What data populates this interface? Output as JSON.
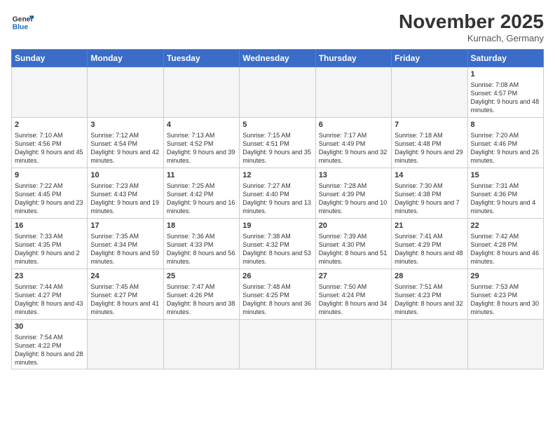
{
  "header": {
    "logo_general": "General",
    "logo_blue": "Blue",
    "month_title": "November 2025",
    "location": "Kurnach, Germany"
  },
  "weekdays": [
    "Sunday",
    "Monday",
    "Tuesday",
    "Wednesday",
    "Thursday",
    "Friday",
    "Saturday"
  ],
  "days": [
    {
      "num": "",
      "info": "",
      "empty": true
    },
    {
      "num": "",
      "info": "",
      "empty": true
    },
    {
      "num": "",
      "info": "",
      "empty": true
    },
    {
      "num": "",
      "info": "",
      "empty": true
    },
    {
      "num": "",
      "info": "",
      "empty": true
    },
    {
      "num": "",
      "info": "",
      "empty": true
    },
    {
      "num": "1",
      "info": "Sunrise: 7:08 AM\nSunset: 4:57 PM\nDaylight: 9 hours\nand 48 minutes."
    },
    {
      "num": "2",
      "info": "Sunrise: 7:10 AM\nSunset: 4:56 PM\nDaylight: 9 hours\nand 45 minutes."
    },
    {
      "num": "3",
      "info": "Sunrise: 7:12 AM\nSunset: 4:54 PM\nDaylight: 9 hours\nand 42 minutes."
    },
    {
      "num": "4",
      "info": "Sunrise: 7:13 AM\nSunset: 4:52 PM\nDaylight: 9 hours\nand 39 minutes."
    },
    {
      "num": "5",
      "info": "Sunrise: 7:15 AM\nSunset: 4:51 PM\nDaylight: 9 hours\nand 35 minutes."
    },
    {
      "num": "6",
      "info": "Sunrise: 7:17 AM\nSunset: 4:49 PM\nDaylight: 9 hours\nand 32 minutes."
    },
    {
      "num": "7",
      "info": "Sunrise: 7:18 AM\nSunset: 4:48 PM\nDaylight: 9 hours\nand 29 minutes."
    },
    {
      "num": "8",
      "info": "Sunrise: 7:20 AM\nSunset: 4:46 PM\nDaylight: 9 hours\nand 26 minutes."
    },
    {
      "num": "9",
      "info": "Sunrise: 7:22 AM\nSunset: 4:45 PM\nDaylight: 9 hours\nand 23 minutes."
    },
    {
      "num": "10",
      "info": "Sunrise: 7:23 AM\nSunset: 4:43 PM\nDaylight: 9 hours\nand 19 minutes."
    },
    {
      "num": "11",
      "info": "Sunrise: 7:25 AM\nSunset: 4:42 PM\nDaylight: 9 hours\nand 16 minutes."
    },
    {
      "num": "12",
      "info": "Sunrise: 7:27 AM\nSunset: 4:40 PM\nDaylight: 9 hours\nand 13 minutes."
    },
    {
      "num": "13",
      "info": "Sunrise: 7:28 AM\nSunset: 4:39 PM\nDaylight: 9 hours\nand 10 minutes."
    },
    {
      "num": "14",
      "info": "Sunrise: 7:30 AM\nSunset: 4:38 PM\nDaylight: 9 hours\nand 7 minutes."
    },
    {
      "num": "15",
      "info": "Sunrise: 7:31 AM\nSunset: 4:36 PM\nDaylight: 9 hours\nand 4 minutes."
    },
    {
      "num": "16",
      "info": "Sunrise: 7:33 AM\nSunset: 4:35 PM\nDaylight: 9 hours\nand 2 minutes."
    },
    {
      "num": "17",
      "info": "Sunrise: 7:35 AM\nSunset: 4:34 PM\nDaylight: 8 hours\nand 59 minutes."
    },
    {
      "num": "18",
      "info": "Sunrise: 7:36 AM\nSunset: 4:33 PM\nDaylight: 8 hours\nand 56 minutes."
    },
    {
      "num": "19",
      "info": "Sunrise: 7:38 AM\nSunset: 4:32 PM\nDaylight: 8 hours\nand 53 minutes."
    },
    {
      "num": "20",
      "info": "Sunrise: 7:39 AM\nSunset: 4:30 PM\nDaylight: 8 hours\nand 51 minutes."
    },
    {
      "num": "21",
      "info": "Sunrise: 7:41 AM\nSunset: 4:29 PM\nDaylight: 8 hours\nand 48 minutes."
    },
    {
      "num": "22",
      "info": "Sunrise: 7:42 AM\nSunset: 4:28 PM\nDaylight: 8 hours\nand 46 minutes."
    },
    {
      "num": "23",
      "info": "Sunrise: 7:44 AM\nSunset: 4:27 PM\nDaylight: 8 hours\nand 43 minutes."
    },
    {
      "num": "24",
      "info": "Sunrise: 7:45 AM\nSunset: 4:27 PM\nDaylight: 8 hours\nand 41 minutes."
    },
    {
      "num": "25",
      "info": "Sunrise: 7:47 AM\nSunset: 4:26 PM\nDaylight: 8 hours\nand 38 minutes."
    },
    {
      "num": "26",
      "info": "Sunrise: 7:48 AM\nSunset: 4:25 PM\nDaylight: 8 hours\nand 36 minutes."
    },
    {
      "num": "27",
      "info": "Sunrise: 7:50 AM\nSunset: 4:24 PM\nDaylight: 8 hours\nand 34 minutes."
    },
    {
      "num": "28",
      "info": "Sunrise: 7:51 AM\nSunset: 4:23 PM\nDaylight: 8 hours\nand 32 minutes."
    },
    {
      "num": "29",
      "info": "Sunrise: 7:53 AM\nSunset: 4:23 PM\nDaylight: 8 hours\nand 30 minutes."
    },
    {
      "num": "30",
      "info": "Sunrise: 7:54 AM\nSunset: 4:22 PM\nDaylight: 8 hours\nand 28 minutes."
    },
    {
      "num": "",
      "info": "",
      "empty": true
    },
    {
      "num": "",
      "info": "",
      "empty": true
    },
    {
      "num": "",
      "info": "",
      "empty": true
    },
    {
      "num": "",
      "info": "",
      "empty": true
    },
    {
      "num": "",
      "info": "",
      "empty": true
    },
    {
      "num": "",
      "info": "",
      "empty": true
    }
  ]
}
